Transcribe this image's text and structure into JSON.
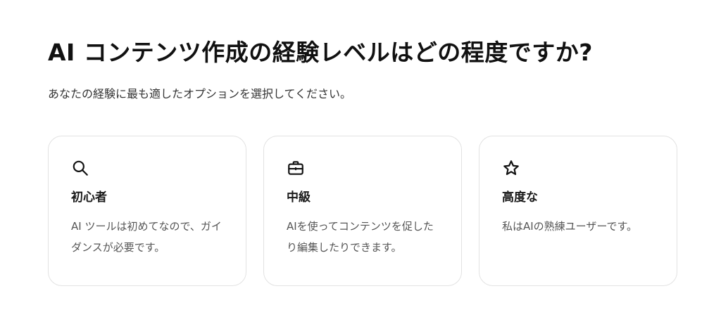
{
  "page": {
    "title": "AI コンテンツ作成の経験レベルはどの程度ですか?",
    "subtitle": "あなたの経験に最も適したオプションを選択してください。"
  },
  "options": [
    {
      "icon": "search-icon",
      "title": "初心者",
      "description": "AI ツールは初めてなので、ガイダンスが必要です。"
    },
    {
      "icon": "briefcase-icon",
      "title": "中級",
      "description": "AIを使ってコンテンツを促したり編集したりできます。"
    },
    {
      "icon": "star-icon",
      "title": "高度な",
      "description": "私はAIの熟練ユーザーです。"
    }
  ]
}
